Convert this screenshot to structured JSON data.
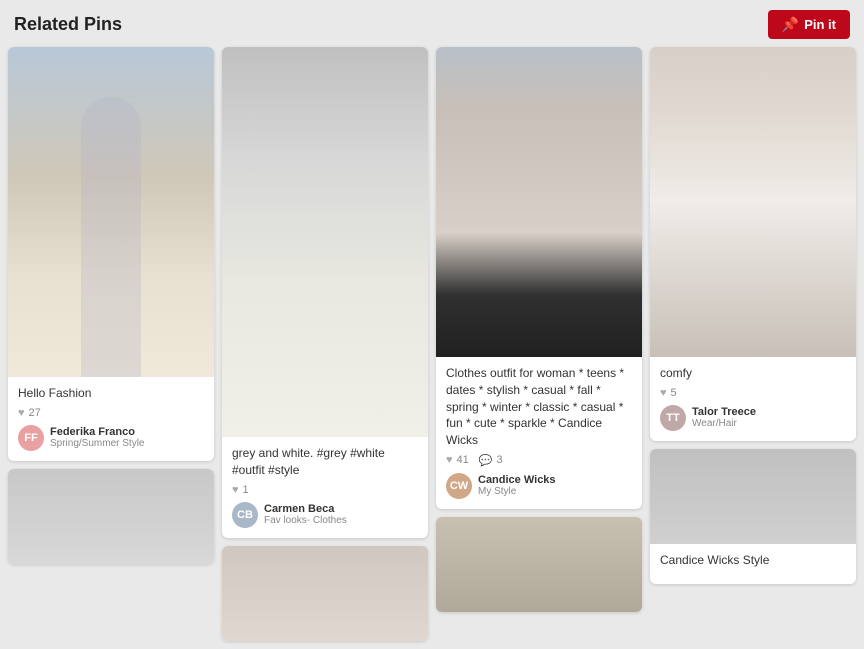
{
  "header": {
    "title": "Related Pins",
    "pin_button_label": "Pin it"
  },
  "columns": [
    {
      "id": "col1",
      "pins": [
        {
          "id": "pin1",
          "image_class": "img-outfit-1",
          "title": "Hello Fashion",
          "stats": "27",
          "user_name": "Federika Franco",
          "board_name": "Spring/Summer Style",
          "avatar_color": "#e8a0a0",
          "avatar_initials": "FF"
        },
        {
          "id": "pin1b",
          "image_class": "img-outfit-2",
          "title": "",
          "stats": "",
          "user_name": "",
          "board_name": "",
          "avatar_color": "#c8b8d0",
          "avatar_initials": ""
        }
      ]
    },
    {
      "id": "col2",
      "pins": [
        {
          "id": "pin2",
          "image_class": "img-grey-white",
          "title": "grey and white. #grey #white #outfit #style",
          "stats": "1",
          "user_name": "Carmen Beca",
          "board_name": "Fav looks- Clothes",
          "avatar_color": "#a8b8c8",
          "avatar_initials": "CB"
        },
        {
          "id": "pin2b",
          "image_class": "img-outfit-bottom-2",
          "title": "",
          "stats": "",
          "user_name": "",
          "board_name": "",
          "avatar_color": "#b0b0b0",
          "avatar_initials": ""
        }
      ]
    },
    {
      "id": "col3",
      "pins": [
        {
          "id": "pin3",
          "image_class": "img-stripes",
          "title": "Clothes outfit for woman * teens * dates * stylish * casual * fall * spring * winter * classic * casual * fun * cute * sparkle * Candice Wicks",
          "stats_heart": "41",
          "stats_comment": "3",
          "user_name": "Candice Wicks",
          "board_name": "My Style",
          "avatar_color": "#d0a888",
          "avatar_initials": "CW"
        },
        {
          "id": "pin3b",
          "image_class": "img-outfit-bottom-3",
          "title": "",
          "stats": "",
          "user_name": "",
          "board_name": "",
          "avatar_color": "#b8a898",
          "avatar_initials": ""
        }
      ]
    },
    {
      "id": "col4",
      "pins": [
        {
          "id": "pin4",
          "image_class": "img-comfy",
          "title": "comfy",
          "stats": "5",
          "user_name": "Talor Treece",
          "board_name": "Wear/Hair",
          "avatar_color": "#c0a8a8",
          "avatar_initials": "TT"
        },
        {
          "id": "pin4b",
          "image_class": "img-grey-coat",
          "title": "Candice Wicks Style",
          "stats": "",
          "user_name": "",
          "board_name": "",
          "avatar_color": "#b0b0b0",
          "avatar_initials": ""
        }
      ]
    }
  ]
}
